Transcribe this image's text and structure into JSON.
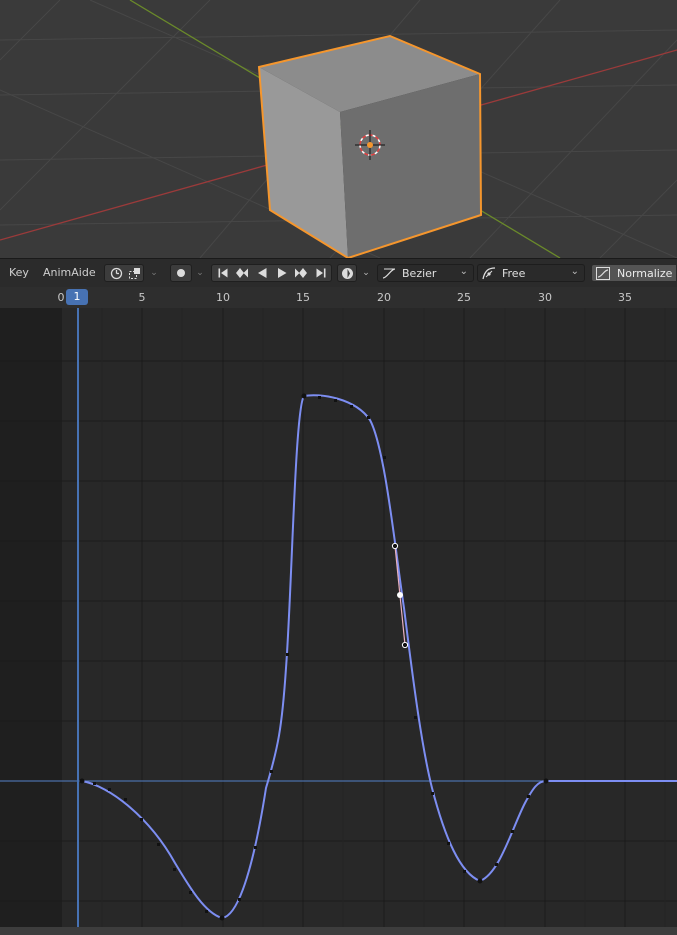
{
  "header": {
    "menus": [
      "Key",
      "AnimAide"
    ],
    "interpolation": "Bezier",
    "handle_type": "Free",
    "normalize_label": "Normalize"
  },
  "ruler": {
    "labels": [
      "0",
      "5",
      "10",
      "15",
      "20",
      "25",
      "30",
      "35"
    ],
    "current_frame": "1"
  },
  "colors": {
    "curve": "#7d8ef2",
    "selection_outline": "#f5962d",
    "playhead": "#4772b3",
    "x_axis": "#9b3a3a",
    "y_axis": "#6a8a2a"
  },
  "icons": [
    "snapping-icon",
    "proportional-icon",
    "keyframe-dot-icon",
    "jump-start-icon",
    "prev-keyframe-icon",
    "play-reverse-icon",
    "play-icon",
    "next-keyframe-icon",
    "jump-end-icon",
    "auto-key-icon",
    "interpolation-icon",
    "handle-icon",
    "normalize-icon",
    "3d-cursor-icon"
  ]
}
